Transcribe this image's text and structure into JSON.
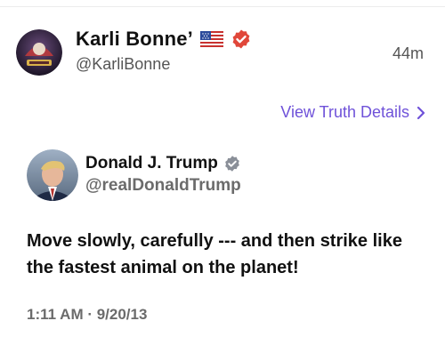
{
  "header_post": {
    "display_name": "Karli Bonne’",
    "handle": "@KarliBonne",
    "time_ago": "44m",
    "flag_icon": "us-flag-icon",
    "verified_color": "#e0473a"
  },
  "view_details": {
    "label": "View Truth Details",
    "color": "#6f52d9"
  },
  "quoted_truth": {
    "display_name": "Donald J. Trump",
    "handle": "@realDonaldTrump",
    "text": "Move slowly, carefully --- and then strike like the fastest animal on the planet!",
    "timestamp": "1:11 AM · 9/20/13",
    "verified_color": "#8a8f98"
  }
}
